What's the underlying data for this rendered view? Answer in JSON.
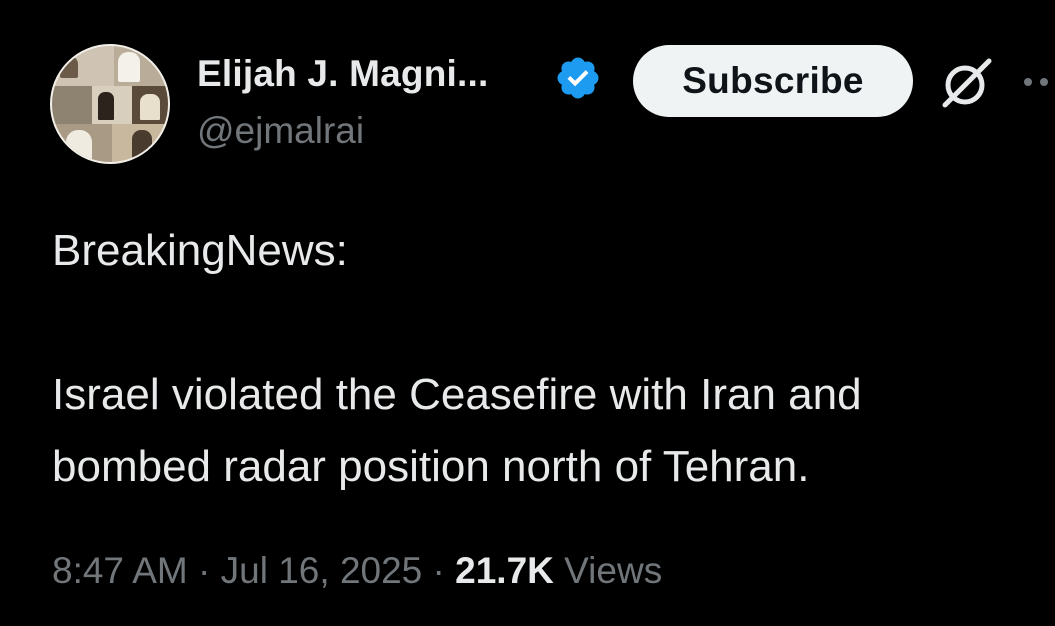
{
  "author": {
    "name": "Elijah J. Magni...",
    "handle": "@ejmalrai",
    "verified_color": "#1d9bf0"
  },
  "actions": {
    "subscribe_label": "Subscribe",
    "grok_icon": "grok-icon",
    "more_icon": "more-icon"
  },
  "tweet": {
    "lines": [
      "BreakingNews:",
      "Israel violated the Ceasefire with Iran and",
      "bombed radar position north of Tehran."
    ]
  },
  "meta": {
    "time": "8:47 AM",
    "separator": "·",
    "date": "Jul 16, 2025",
    "views_count": "21.7K",
    "views_label": "Views"
  },
  "colors": {
    "background": "#000000",
    "primary_text": "#e7e9ea",
    "secondary_text": "#71767b",
    "button_bg": "#eff3f4"
  }
}
